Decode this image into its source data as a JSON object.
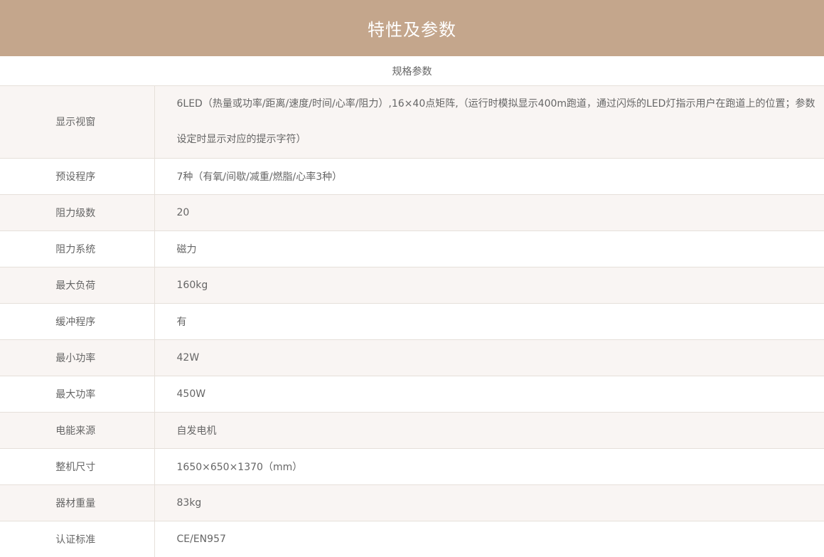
{
  "header": {
    "title": "特性及参数"
  },
  "subheader": {
    "title": "规格参数"
  },
  "specs": [
    {
      "label": "显示视窗",
      "value": "6LED（热量或功率/距离/速度/时间/心率/阻力）,16×40点矩阵,（运行时模拟显示400m跑道，通过闪烁的LED灯指示用户在跑道上的位置；参数设定时显示对应的提示字符）"
    },
    {
      "label": "预设程序",
      "value": "7种（有氧/间歇/减重/燃脂/心率3种）"
    },
    {
      "label": "阻力级数",
      "value": "20"
    },
    {
      "label": "阻力系统",
      "value": "磁力"
    },
    {
      "label": "最大负荷",
      "value": "160kg"
    },
    {
      "label": "缓冲程序",
      "value": "有"
    },
    {
      "label": "最小功率",
      "value": "42W"
    },
    {
      "label": "最大功率",
      "value": "450W"
    },
    {
      "label": "电能来源",
      "value": "自发电机"
    },
    {
      "label": "整机尺寸",
      "value": "1650×650×1370（mm）"
    },
    {
      "label": "器材重量",
      "value": "83kg"
    },
    {
      "label": "认证标准",
      "value": "CE/EN957"
    }
  ],
  "colors": {
    "header_bg": "#c4a68c",
    "row_alt_bg": "#f9f5f3",
    "text": "#666666",
    "border": "#e6e0da"
  }
}
